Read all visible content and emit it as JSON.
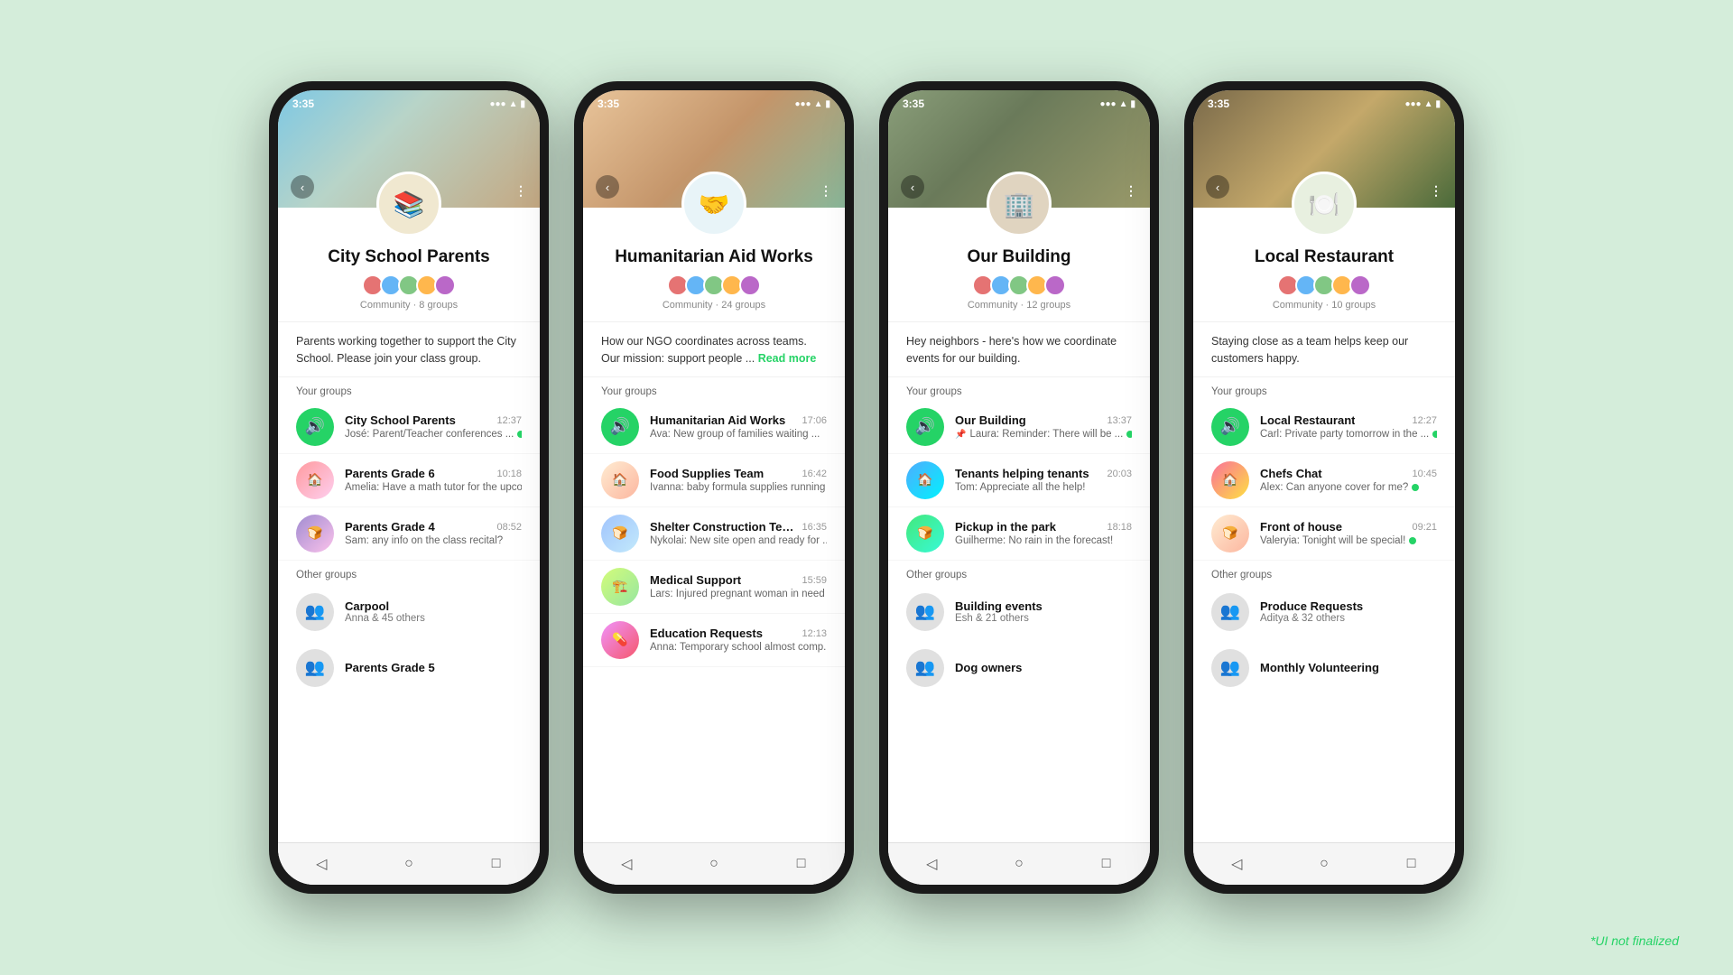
{
  "background_color": "#d4edda",
  "watermark": "*UI not finalized",
  "phones": [
    {
      "id": "phone-school",
      "status_time": "3:35",
      "header_bg_class": "header-bg-school",
      "icon_class": "school-icon-bg",
      "icon_emoji": "📚",
      "community_name": "City School Parents",
      "community_meta": "Community · 8 groups",
      "description": "Parents working together to support the City School. Please join your class group.",
      "has_read_more": false,
      "your_groups_label": "Your groups",
      "your_groups": [
        {
          "name": "City School Parents",
          "time": "12:37",
          "last_msg": "José: Parent/Teacher conferences ...",
          "avatar_class": "group-avatar-speaker",
          "avatar_emoji": "🔊",
          "has_dot": true
        },
        {
          "name": "Parents Grade 6",
          "time": "10:18",
          "last_msg": "Amelia: Have a math tutor for the upco...",
          "avatar_class": "group-avatar-img1",
          "avatar_emoji": "",
          "has_dot": false
        },
        {
          "name": "Parents Grade 4",
          "time": "08:52",
          "last_msg": "Sam: any info on the class recital?",
          "avatar_class": "group-avatar-img2",
          "avatar_emoji": "",
          "has_dot": false
        }
      ],
      "other_groups_label": "Other groups",
      "other_groups": [
        {
          "name": "Carpool",
          "members": "Anna & 45 others"
        },
        {
          "name": "Parents Grade 5",
          "members": ""
        }
      ]
    },
    {
      "id": "phone-humanitarian",
      "status_time": "3:35",
      "header_bg_class": "header-bg-humanitarian",
      "icon_class": "humanitarian-icon-bg",
      "icon_emoji": "🤝",
      "community_name": "Humanitarian Aid Works",
      "community_meta": "Community · 24 groups",
      "description": "How our NGO coordinates across teams. Our mission: support people ...",
      "has_read_more": true,
      "read_more_label": "Read more",
      "your_groups_label": "Your groups",
      "your_groups": [
        {
          "name": "Humanitarian Aid Works",
          "time": "17:06",
          "last_msg": "Ava: New group of families waiting ...",
          "avatar_class": "group-avatar-speaker",
          "avatar_emoji": "🔊",
          "has_dot": false
        },
        {
          "name": "Food Supplies Team",
          "time": "16:42",
          "last_msg": "Ivanna: baby formula supplies running ...",
          "avatar_class": "group-avatar-img3",
          "avatar_emoji": "",
          "has_dot": false
        },
        {
          "name": "Shelter Construction Team",
          "time": "16:35",
          "last_msg": "Nykolai: New site open and ready for ...",
          "avatar_class": "group-avatar-img4",
          "avatar_emoji": "",
          "has_dot": false
        },
        {
          "name": "Medical Support",
          "time": "15:59",
          "last_msg": "Lars: Injured pregnant woman in need ...",
          "avatar_class": "group-avatar-img5",
          "avatar_emoji": "",
          "has_dot": false
        },
        {
          "name": "Education Requests",
          "time": "12:13",
          "last_msg": "Anna: Temporary school almost comp...",
          "avatar_class": "group-avatar-img6",
          "avatar_emoji": "",
          "has_dot": false
        }
      ],
      "other_groups_label": "",
      "other_groups": []
    },
    {
      "id": "phone-building",
      "status_time": "3:35",
      "header_bg_class": "header-bg-building",
      "icon_class": "building-icon-bg",
      "icon_emoji": "🏢",
      "community_name": "Our Building",
      "community_meta": "Community · 12 groups",
      "description": "Hey neighbors - here's how we coordinate events for our building.",
      "has_read_more": false,
      "your_groups_label": "Your groups",
      "your_groups": [
        {
          "name": "Our Building",
          "time": "13:37",
          "last_msg": "Laura: Reminder:  There will be ...",
          "avatar_class": "group-avatar-speaker",
          "avatar_emoji": "🔊",
          "has_dot": true,
          "has_pin": true
        },
        {
          "name": "Tenants helping tenants",
          "time": "20:03",
          "last_msg": "Tom: Appreciate all the help!",
          "avatar_class": "group-avatar-img7",
          "avatar_emoji": "",
          "has_dot": false
        },
        {
          "name": "Pickup in the park",
          "time": "18:18",
          "last_msg": "Guilherme: No rain in the forecast!",
          "avatar_class": "group-avatar-img8",
          "avatar_emoji": "",
          "has_dot": false
        }
      ],
      "other_groups_label": "Other groups",
      "other_groups": [
        {
          "name": "Building events",
          "members": "Esh & 21 others"
        },
        {
          "name": "Dog owners",
          "members": ""
        }
      ]
    },
    {
      "id": "phone-restaurant",
      "status_time": "3:35",
      "header_bg_class": "header-bg-restaurant",
      "icon_class": "restaurant-icon-bg",
      "icon_emoji": "🍽️",
      "community_name": "Local Restaurant",
      "community_meta": "Community · 10 groups",
      "description": "Staying close as a team helps keep our customers happy.",
      "has_read_more": false,
      "your_groups_label": "Your groups",
      "your_groups": [
        {
          "name": "Local Restaurant",
          "time": "12:27",
          "last_msg": "Carl: Private party tomorrow in the ...",
          "avatar_class": "group-avatar-speaker",
          "avatar_emoji": "🔊",
          "has_dot": true
        },
        {
          "name": "Chefs Chat",
          "time": "10:45",
          "last_msg": "Alex: Can anyone cover for me?",
          "avatar_class": "group-avatar-img9",
          "avatar_emoji": "",
          "has_dot": true
        },
        {
          "name": "Front of house",
          "time": "09:21",
          "last_msg": "Valeryia: Tonight will be special!",
          "avatar_class": "group-avatar-img3",
          "avatar_emoji": "",
          "has_dot": true
        }
      ],
      "other_groups_label": "Other groups",
      "other_groups": [
        {
          "name": "Produce Requests",
          "members": "Aditya & 32 others"
        },
        {
          "name": "Monthly Volunteering",
          "members": ""
        }
      ]
    }
  ]
}
